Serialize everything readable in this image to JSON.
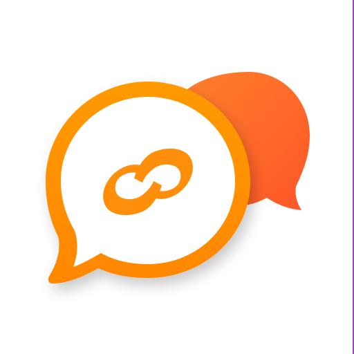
{
  "app_icon": {
    "icon_name": "chat-link-logo",
    "colors": {
      "background": "#ffffff",
      "front_bubble_ring_top": "#ff9a00",
      "front_bubble_ring_bottom": "#ff8a00",
      "back_bubble_top": "#ff7a2a",
      "back_bubble_bottom": "#ff5a28",
      "link_symbol": "#ff8f0a",
      "inner_fill": "#ffffff",
      "edge_line": "#a23ad6"
    }
  }
}
